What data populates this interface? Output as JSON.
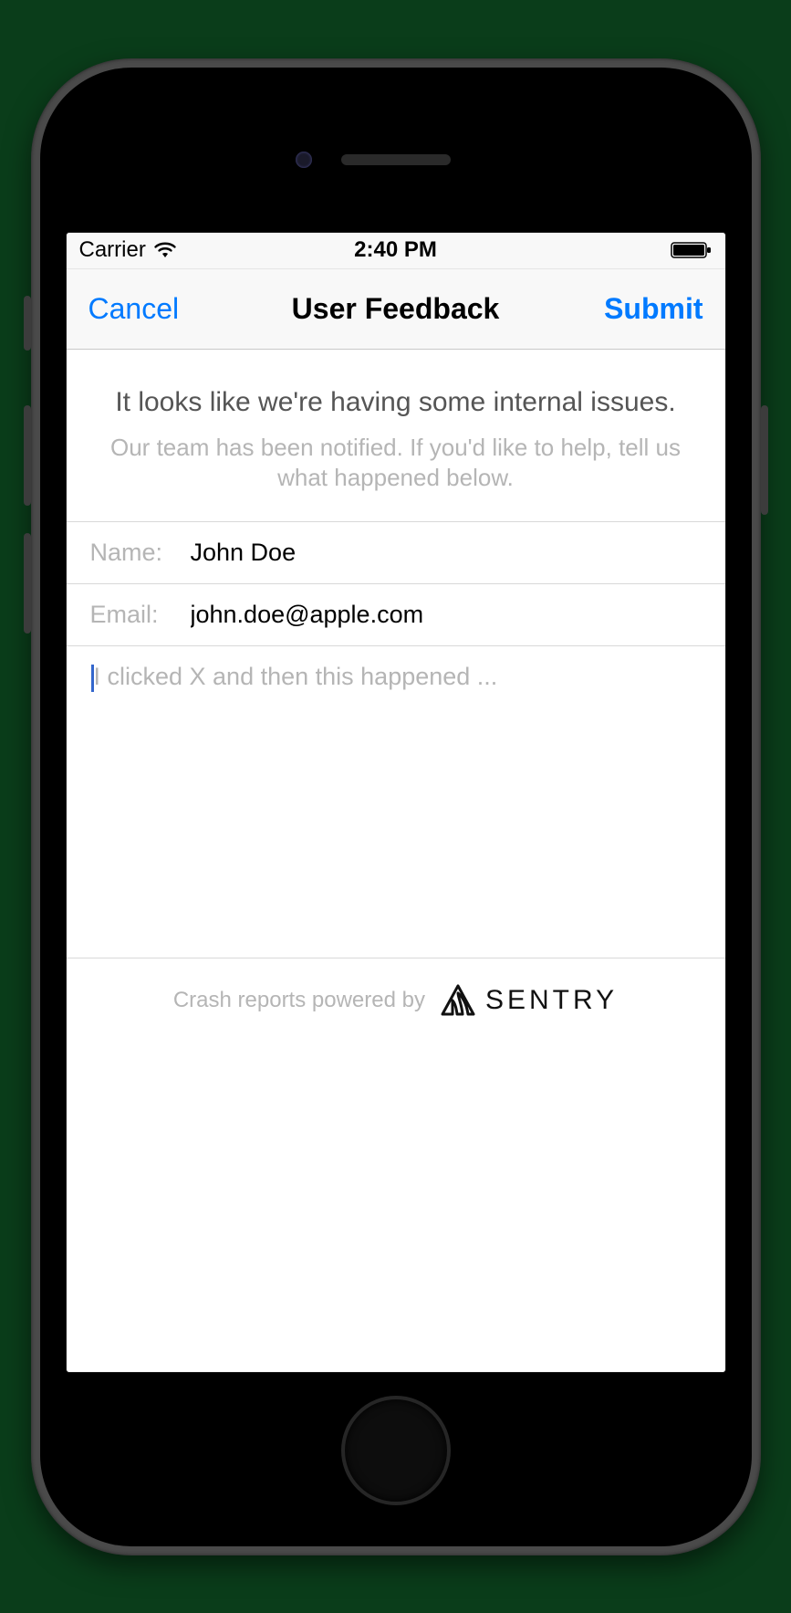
{
  "status_bar": {
    "carrier": "Carrier",
    "time": "2:40 PM"
  },
  "nav": {
    "cancel": "Cancel",
    "title": "User Feedback",
    "submit": "Submit"
  },
  "intro": {
    "title": "It looks like we're having some internal issues.",
    "subtitle": "Our team has been notified. If you'd like to help, tell us what happened below."
  },
  "fields": {
    "name_label": "Name:",
    "name_value": "John Doe",
    "email_label": "Email:",
    "email_value": "john.doe@apple.com",
    "description_placeholder": "I clicked X and then this happened ...",
    "description_value": ""
  },
  "footer": {
    "powered_by": "Crash reports powered by",
    "brand": "SENTRY"
  }
}
